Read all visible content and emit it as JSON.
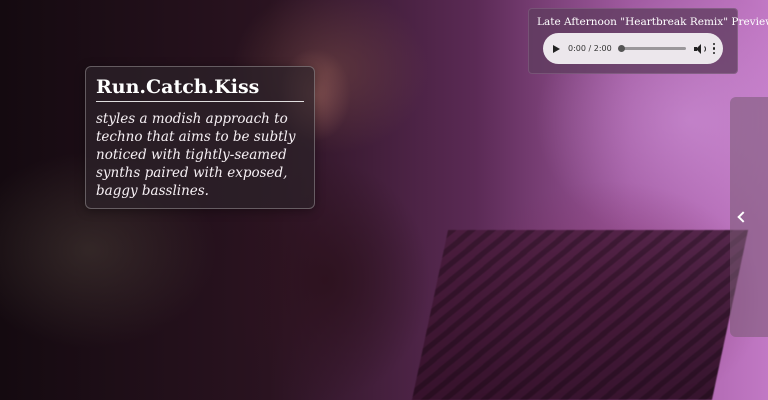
{
  "artist": {
    "name": "Run.Catch.Kiss",
    "description": "styles a modish approach to techno that aims to be subtly noticed with tightly-seamed synths paired with exposed, baggy basslines."
  },
  "audio": {
    "title": "Late Afternoon \"Heartbreak Remix\" Preview",
    "time_display": "0:00 / 2:00",
    "progress_fraction": 0
  },
  "icons": {
    "play": "play-icon",
    "volume": "volume-icon",
    "more": "more-vert-icon",
    "side_toggle": "chevron-left-icon"
  },
  "colors": {
    "card_bg": "#2d232a",
    "audio_card_bg": "#5f3c5f",
    "player_bg": "#ece7ec",
    "accent": "#c178c4"
  }
}
